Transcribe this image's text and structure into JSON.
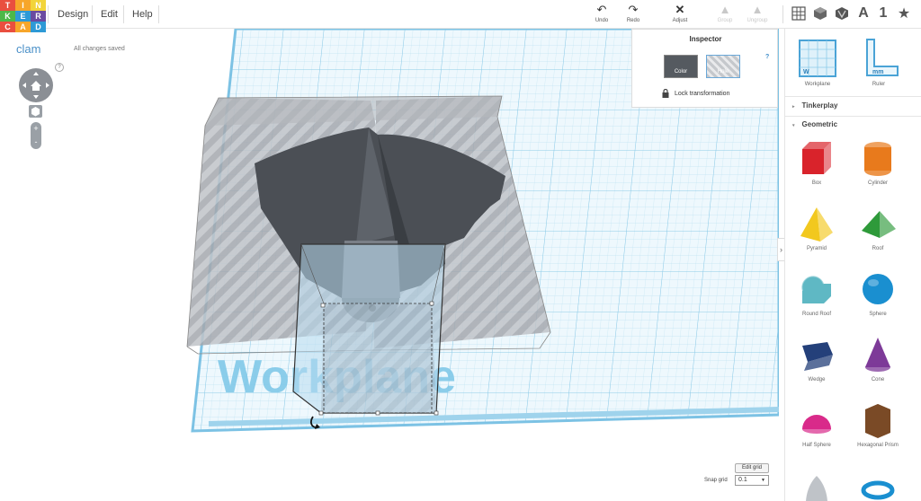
{
  "logo": {
    "letters": [
      "T",
      "I",
      "N",
      "K",
      "E",
      "R",
      "C",
      "A",
      "D"
    ],
    "colors": [
      "#e94f3f",
      "#f7a62a",
      "#f2d43a",
      "#4db848",
      "#2e9ad6",
      "#6a4aa0",
      "#e94f3f",
      "#f7a62a",
      "#2e9ad6"
    ]
  },
  "menu": {
    "design": "Design",
    "edit": "Edit",
    "help": "Help"
  },
  "toolbar": {
    "undo": "Undo",
    "redo": "Redo",
    "adjust": "Adjust",
    "group": "Group",
    "ungroup": "Ungroup"
  },
  "view_buttons": [
    "grid-view-icon",
    "cube-view-icon",
    "shapes-view-icon",
    "text-view-icon",
    "number-view-icon",
    "star-view-icon"
  ],
  "view_letters": {
    "text": "A",
    "number": "1",
    "star": "★"
  },
  "design": {
    "title": "clam",
    "status": "All changes saved",
    "help": "?"
  },
  "inspector": {
    "title": "Inspector",
    "color_label": "Color",
    "hole_label": "Hole",
    "help": "?",
    "lock_label": "Lock transformation"
  },
  "workplane": {
    "text": "Workplane"
  },
  "sidebar": {
    "top_items": [
      {
        "label": "Workplane"
      },
      {
        "label": "Ruler"
      }
    ],
    "sections": {
      "tinkerplay": "Tinkerplay",
      "geometric": "Geometric"
    },
    "shapes": [
      {
        "label": "Box",
        "color": "#d9232b"
      },
      {
        "label": "Cylinder",
        "color": "#e87a1c"
      },
      {
        "label": "Pyramid",
        "color": "#f2c81e"
      },
      {
        "label": "Roof",
        "color": "#2e9a3a"
      },
      {
        "label": "Round Roof",
        "color": "#5fb8c4"
      },
      {
        "label": "Sphere",
        "color": "#1a8fd0"
      },
      {
        "label": "Wedge",
        "color": "#24407a"
      },
      {
        "label": "Cone",
        "color": "#7d3a98"
      },
      {
        "label": "Half Sphere",
        "color": "#d92a8a"
      },
      {
        "label": "Hexagonal Prism",
        "color": "#7a4a26"
      }
    ]
  },
  "grid": {
    "edit_label": "Edit grid",
    "snap_label": "Snap grid",
    "snap_value": "0.1"
  }
}
